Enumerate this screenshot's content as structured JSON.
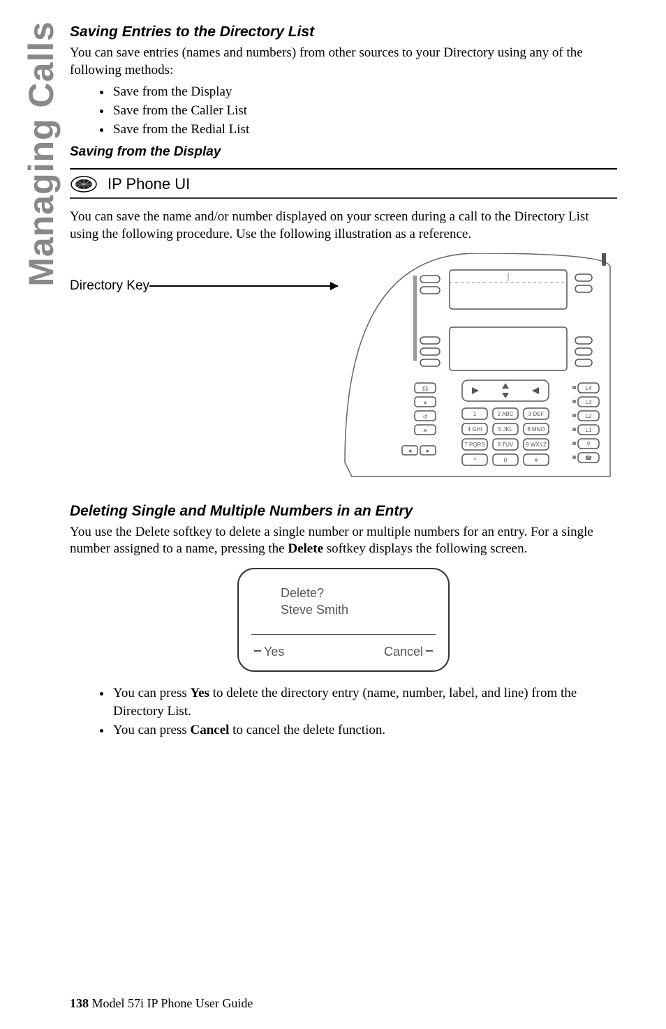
{
  "sideLabel": "Managing Calls",
  "section1": {
    "heading": "Saving Entries to the Directory List",
    "intro": "You can save entries (names and numbers) from other sources to your Directory using any of the following methods:",
    "bullets": [
      "Save from the Display",
      "Save from the Caller List",
      "Save from the Redial List"
    ]
  },
  "section2": {
    "heading": "Saving from the Display",
    "uiLabel": "IP Phone UI",
    "body": "You can save the name and/or number displayed on your screen during a call to the Directory List using the following procedure. Use the following illustration as a reference.",
    "figureLabel": "Directory Key"
  },
  "section3": {
    "heading": "Deleting Single and Multiple Numbers in an Entry",
    "body1": "You use the Delete softkey to delete a single number or multiple numbers for an entry. For a single number assigned to a name, pressing the ",
    "boldDelete": "Delete",
    "body2": " softkey displays the following screen.",
    "screen": {
      "line1": "Delete?",
      "line2": "Steve Smith",
      "leftBtn": "Yes",
      "rightBtn": "Cancel"
    },
    "bullets": [
      {
        "pre": "You can press ",
        "bold": "Yes",
        "post": " to delete the directory entry (name, number, label, and line) from the Directory List."
      },
      {
        "pre": "You can press ",
        "bold": "Cancel",
        "post": " to cancel the delete function."
      }
    ]
  },
  "footer": {
    "page": "138",
    "rest": "  Model 57i IP Phone User Guide"
  }
}
